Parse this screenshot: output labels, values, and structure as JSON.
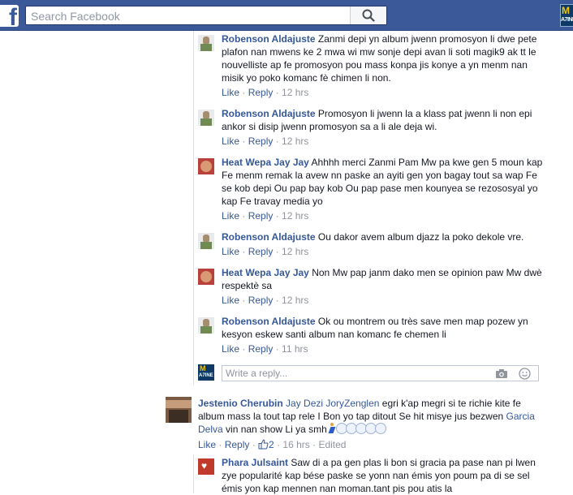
{
  "search": {
    "placeholder": "Search Facebook"
  },
  "app_icon": {
    "line1": "M",
    "line2": "A7INE"
  },
  "replies": [
    {
      "author": "Robenson Aldajuste",
      "text": "Zanmi depi yn album jwenn promosyon li dwe pete plafon nan mwens ke 2 mwa wi mw sonje depi avan li soti magik9 ak tt le nouvelliste ap fe promosyon pou mass konpa jis konye a yn menm nan misik yo poko komanc fè chimen li non.",
      "like": "Like",
      "reply": "Reply",
      "time": "12 hrs"
    },
    {
      "author": "Robenson Aldajuste",
      "text": "Promosyon li jwenn la a klass pat jwenn li non epi ankor si disip jwenn promosyon sa a li ale deja wi.",
      "like": "Like",
      "reply": "Reply",
      "time": "12 hrs"
    },
    {
      "author": "Heat Wepa Jay Jay",
      "text": "Ahhhh merci Zanmi Pam Mw pa kwe gen 5 moun kap Fe menm remak la avew nn paske an ayiti gen yon bagay tout sa wap Fe se kob depi Ou pap bay kob Ou pap pase men kounyea se rezososyal yo kap Fe travay media yo",
      "like": "Like",
      "reply": "Reply",
      "time": "12 hrs"
    },
    {
      "author": "Robenson Aldajuste",
      "text": "Ou dakor avem album djazz la poko dekole vre.",
      "like": "Like",
      "reply": "Reply",
      "time": "12 hrs"
    },
    {
      "author": "Heat Wepa Jay Jay",
      "text": "Non Mw pap janm dako men se opinion paw Mw dwè respektè sa",
      "like": "Like",
      "reply": "Reply",
      "time": "12 hrs"
    },
    {
      "author": "Robenson Aldajuste",
      "text": "Ok ou montrem ou très save men map pozew yn kesyon eskew santi album nan komanc fe chemen li",
      "like": "Like",
      "reply": "Reply",
      "time": "11 hrs"
    }
  ],
  "reply_box": {
    "placeholder": "Write a reply..."
  },
  "comment": {
    "author": "Jestenio Cherubin",
    "tags": "Jay Dezi JoryZenglen",
    "text": "egri k'ap megri si te richie kite fe album mass la tout tap rele I Bon yo tap ditout Se hit misye jus bezwen",
    "tag2": "Garcia Delva",
    "text2": "vin nan show Li ya smh",
    "like": "Like",
    "reply": "Reply",
    "likes_count": "2",
    "time": "16 hrs",
    "edited": "Edited"
  },
  "nested": {
    "author": "Phara Julsaint",
    "text": "Saw di a pa gen plas li bon si gracia pa pase nan pi lwen zye popularité kap bése paske se yonn nan émis yon poum pa di se sel émis yon kap mennen nan moman.tant pis pou atis la"
  },
  "colors": {
    "brand": "#3b5998",
    "link": "#365899",
    "meta": "#90949c"
  }
}
